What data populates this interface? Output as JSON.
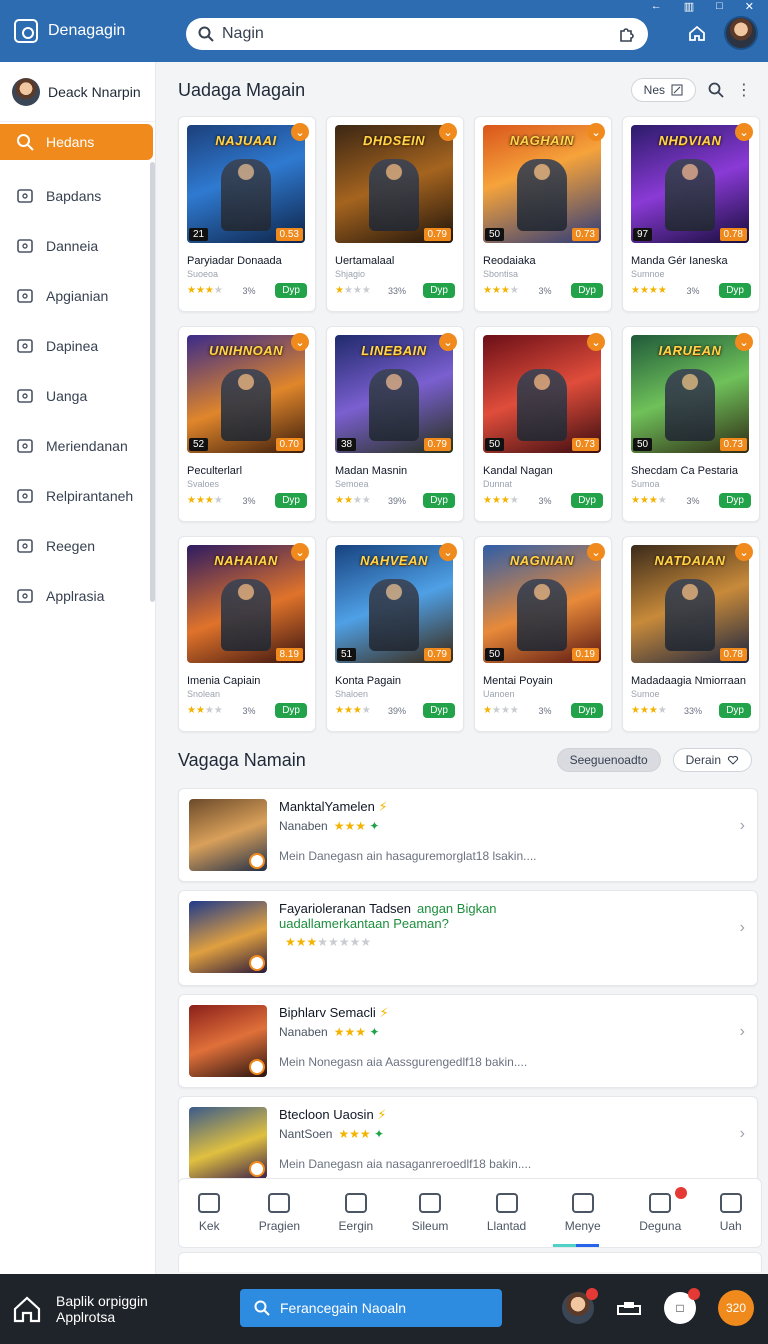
{
  "app": {
    "title": "Denagagin"
  },
  "search": {
    "value": "Nagin"
  },
  "sidebar": {
    "profile_name": "Deack Nnarpin",
    "items": [
      {
        "label": "Hedans",
        "icon": "search-icon",
        "active": true
      },
      {
        "label": "Bapdans",
        "icon": "card-icon"
      },
      {
        "label": "Danneia",
        "icon": "briefcase-icon"
      },
      {
        "label": "Apgianian",
        "icon": "bag-icon"
      },
      {
        "label": "Dapinea",
        "icon": "card-icon"
      },
      {
        "label": "Uanga",
        "icon": "chat-icon"
      },
      {
        "label": "Meriendanan",
        "icon": "image-icon"
      },
      {
        "label": "Relpirantaneh",
        "icon": "list-icon"
      },
      {
        "label": "Reegen",
        "icon": "grid-icon"
      },
      {
        "label": "Applrasia",
        "icon": "shield-icon"
      }
    ]
  },
  "section1": {
    "title": "Uadaga Magain",
    "sort_label": "Nes"
  },
  "cards": [
    {
      "art": "NAJUAAI",
      "name": "Paryiadar Donaada",
      "sub": "Suoeoa",
      "left": "21",
      "right": "0.53",
      "stars": 3,
      "pct": "3%",
      "btn": "Dyp",
      "bg": "linear-gradient(160deg,#1c3f7a,#2f7ad1 45%,#0e2347)"
    },
    {
      "art": "DHDSEIN",
      "name": "Uertamalaal",
      "sub": "Shjagio",
      "left": "",
      "right": "0.79",
      "stars": 1,
      "pct": "33%",
      "btn": "Dyp",
      "bg": "linear-gradient(160deg,#3b2614,#a5641f 50%,#1f140b)"
    },
    {
      "art": "NAGHAIN",
      "name": "Reodaiaka",
      "sub": "Sbontisa",
      "left": "50",
      "right": "0.73",
      "stars": 3,
      "pct": "3%",
      "btn": "Dyp",
      "bg": "linear-gradient(160deg,#d9551b,#f6a33b 40%,#2c3a7a)"
    },
    {
      "art": "NHDVIAN",
      "name": "Manda Gér Ianeska",
      "sub": "Sumnoe",
      "left": "97",
      "right": "0.78",
      "stars": 4,
      "pct": "3%",
      "btn": "Dyp",
      "bg": "linear-gradient(160deg,#2b1b69,#8a3ad6 50%,#160d3a)"
    },
    {
      "art": "UNIHNOAN",
      "name": "Peculterlarl",
      "sub": "Svaloes",
      "left": "52",
      "right": "0.70",
      "stars": 3,
      "pct": "3%",
      "btn": "Dyp",
      "bg": "linear-gradient(160deg,#3a2a8a,#e0862b 55%,#3a1c0c)"
    },
    {
      "art": "LINEBAIN",
      "name": "Madan Masnin",
      "sub": "Semoea",
      "left": "38",
      "right": "0.79",
      "stars": 2,
      "pct": "39%",
      "btn": "Dyp",
      "bg": "linear-gradient(160deg,#1f2a6b,#7a5fd0 50%,#243019)"
    },
    {
      "art": "",
      "name": "Kandal Nagan",
      "sub": "Dunnat",
      "left": "50",
      "right": "0.73",
      "stars": 3,
      "pct": "3%",
      "btn": "Dyp",
      "bg": "linear-gradient(160deg,#6b0f17,#e04d3b 50%,#3a0c10)"
    },
    {
      "art": "IARUEAN",
      "name": "Shecdam Ca Pestaria",
      "sub": "Sumoa",
      "left": "50",
      "right": "0.73",
      "stars": 3,
      "pct": "3%",
      "btn": "Dyp",
      "bg": "linear-gradient(160deg,#1f5a3a,#6fc15a 50%,#2f2a14)"
    },
    {
      "art": "NAHAIAN",
      "name": "Imenia Capiain",
      "sub": "Snolean",
      "left": "",
      "right": "8.19",
      "stars": 2,
      "pct": "3%",
      "btn": "Dyp",
      "bg": "linear-gradient(160deg,#2d1b62,#e0732b 55%,#3a1410)"
    },
    {
      "art": "NAHVEAN",
      "name": "Konta Pagain",
      "sub": "Shaloen",
      "left": "51",
      "right": "0.79",
      "stars": 3,
      "pct": "39%",
      "btn": "Dyp",
      "bg": "linear-gradient(160deg,#17427e,#4fa0e6 50%,#3a2610)"
    },
    {
      "art": "NAGNIAN",
      "name": "Mentai Poyain",
      "sub": "Uanoen",
      "left": "50",
      "right": "0.19",
      "stars": 1,
      "pct": "3%",
      "btn": "Dyp",
      "bg": "linear-gradient(160deg,#2f5ea8,#e88a3a 55%,#5a1712)"
    },
    {
      "art": "NATDAIAN",
      "name": "Madadaagia Nmiorraan",
      "sub": "Sumoe",
      "left": "",
      "right": "0.78",
      "stars": 3,
      "pct": "33%",
      "btn": "Dyp",
      "bg": "linear-gradient(160deg,#3a2a1a,#c88a3a 50%,#1a2440)"
    }
  ],
  "section2": {
    "title": "Vagaga Namain",
    "filter_label": "Seeguenoadto",
    "dropdown_label": "Derain"
  },
  "rows": [
    {
      "title": "ManktalYamelen",
      "meta": "Nanaben",
      "stars": 3,
      "desc": "Mein Danegasn ain hasaguremorglat18 lsakin....",
      "bg": "linear-gradient(160deg,#6b4a2a,#d9a05a 50%,#233049)"
    },
    {
      "title": "Fayarioleranan Tadsen",
      "title_green": "angan Bigkan",
      "line2": "uadallamerkantaan Peaman?",
      "meta": "",
      "stars": 3,
      "desc": "",
      "bg": "linear-gradient(160deg,#1f3a8a,#e0a040 55%,#2a1a3a)"
    },
    {
      "title": "Biphlarv Semacli",
      "meta": "Nanaben",
      "stars": 3,
      "desc": "Mein Nonegasn aia Aassgurengedlf18 bakin....",
      "bg": "linear-gradient(160deg,#8a1f1a,#e0703a 50%,#2a1410)"
    },
    {
      "title": "Btecloon Uaosin",
      "meta": "NantSoen",
      "stars": 3,
      "desc": "Mein Danegasn aia nasaganreroedlf18 bakin....",
      "bg": "linear-gradient(160deg,#3a5a8a,#e0c040 55%,#3a1f4a)"
    }
  ],
  "tabs": [
    {
      "label": "Kek",
      "icon": "home-icon"
    },
    {
      "label": "Pragien",
      "icon": "download-icon"
    },
    {
      "label": "Eergin",
      "icon": "edit-icon"
    },
    {
      "label": "Sileum",
      "icon": "shield-icon"
    },
    {
      "label": "Llantad",
      "icon": "lock-icon"
    },
    {
      "label": "Menye",
      "icon": "folder-icon"
    },
    {
      "label": "Deguna",
      "icon": "coins-icon"
    },
    {
      "label": "Uah",
      "icon": "user-icon"
    }
  ],
  "taskbar": {
    "app_line1": "Baplik orpiggin",
    "app_line2": "Applrotsa",
    "search_label": "Ferancegain Naoaln",
    "orange_label": "320"
  }
}
